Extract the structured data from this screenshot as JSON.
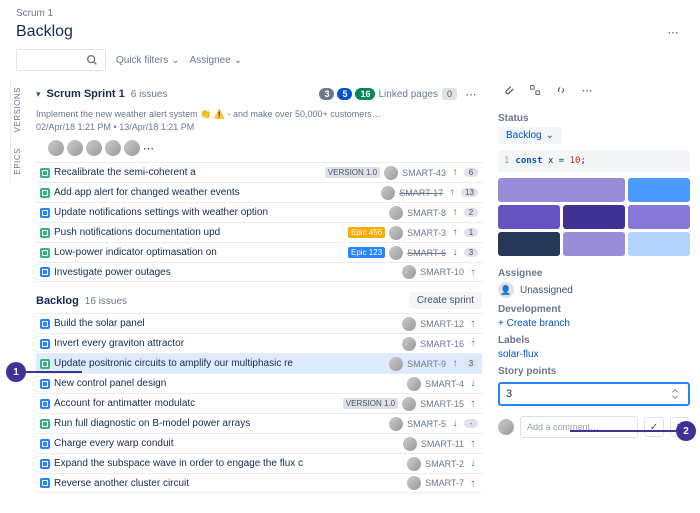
{
  "breadcrumb": "Scrum 1",
  "page_title": "Backlog",
  "filters": {
    "quick": "Quick filters",
    "assignee": "Assignee"
  },
  "rails": [
    "VERSIONS",
    "EPICS"
  ],
  "sprint": {
    "name": "Scrum Sprint 1",
    "count": "6 issues",
    "pills": [
      "3",
      "5",
      "16"
    ],
    "linked_label": "Linked pages",
    "linked_count": "0",
    "desc": "Implement the new weather alert system 👏 ⚠️ - and make over 50,000+ customers…",
    "dates": "02/Apr/18 1:21 PM • 13/Apr/18 1:21 PM",
    "issues": [
      {
        "t": "story",
        "s": "Recalibrate the semi-coherent a",
        "tag": "VERSION 1.0",
        "tagc": "",
        "k": "SMART-43",
        "p": "up",
        "e": "6"
      },
      {
        "t": "story",
        "s": "Add app alert for changed weather events",
        "k": "SMART-17",
        "kd": true,
        "p": "up",
        "e": "13"
      },
      {
        "t": "task",
        "s": "Update notifications settings with weather option",
        "k": "SMART-8",
        "p": "up",
        "e": "2"
      },
      {
        "t": "story",
        "s": "Push notifications documentation upd",
        "tag": "Epic 456",
        "tagc": "orange",
        "k": "SMART-3",
        "p": "up",
        "e": "1"
      },
      {
        "t": "story",
        "s": "Low-power indicator optimasation on",
        "tag": "Epic 123",
        "tagc": "blue",
        "k": "SMART-6",
        "kd": true,
        "p": "down",
        "e": "3"
      },
      {
        "t": "task",
        "s": "Investigate power outages",
        "k": "SMART-10",
        "p": "up"
      }
    ]
  },
  "backlog": {
    "title": "Backlog",
    "count": "16 issues",
    "create": "Create sprint",
    "issues": [
      {
        "t": "task",
        "s": "Build the solar panel",
        "k": "SMART-12",
        "p": "up"
      },
      {
        "t": "task",
        "s": "Invert every graviton attractor",
        "k": "SMART-16",
        "p": "up"
      },
      {
        "t": "story",
        "s": "Update positronic circuits to amplify our multiphasic re",
        "k": "SMART-9",
        "p": "up",
        "e": "3",
        "sel": true
      },
      {
        "t": "task",
        "s": "New control panel design",
        "k": "SMART-4",
        "p": "down"
      },
      {
        "t": "task",
        "s": "Account for antimatter modulatc",
        "tag": "VERSION 1.0",
        "k": "SMART-15",
        "p": "up"
      },
      {
        "t": "story",
        "s": "Run full diagnostic on B-model power arrays",
        "k": "SMART-5",
        "p": "down",
        "e": "-"
      },
      {
        "t": "task",
        "s": "Charge every warp conduit",
        "k": "SMART-11",
        "p": "up"
      },
      {
        "t": "task",
        "s": "Expand the subspace wave in order to engage the flux c",
        "k": "SMART-2",
        "p": "down"
      },
      {
        "t": "task",
        "s": "Reverse another cluster circuit",
        "k": "SMART-7",
        "p": "up"
      }
    ]
  },
  "side": {
    "status_label": "Status",
    "status_value": "Backlog",
    "code_line": "1",
    "code_kw": "const",
    "code_var": "x",
    "code_eq": "=",
    "code_val": "10",
    "code_end": ";",
    "assignee_label": "Assignee",
    "assignee_value": "Unassigned",
    "dev_label": "Development",
    "dev_link": "+  Create branch",
    "labels_label": "Labels",
    "labels_value": "solar-flux",
    "sp_label": "Story points",
    "sp_value": "3",
    "comment_ph": "Add a comment…"
  },
  "callouts": {
    "c1": "1",
    "c2": "2"
  }
}
